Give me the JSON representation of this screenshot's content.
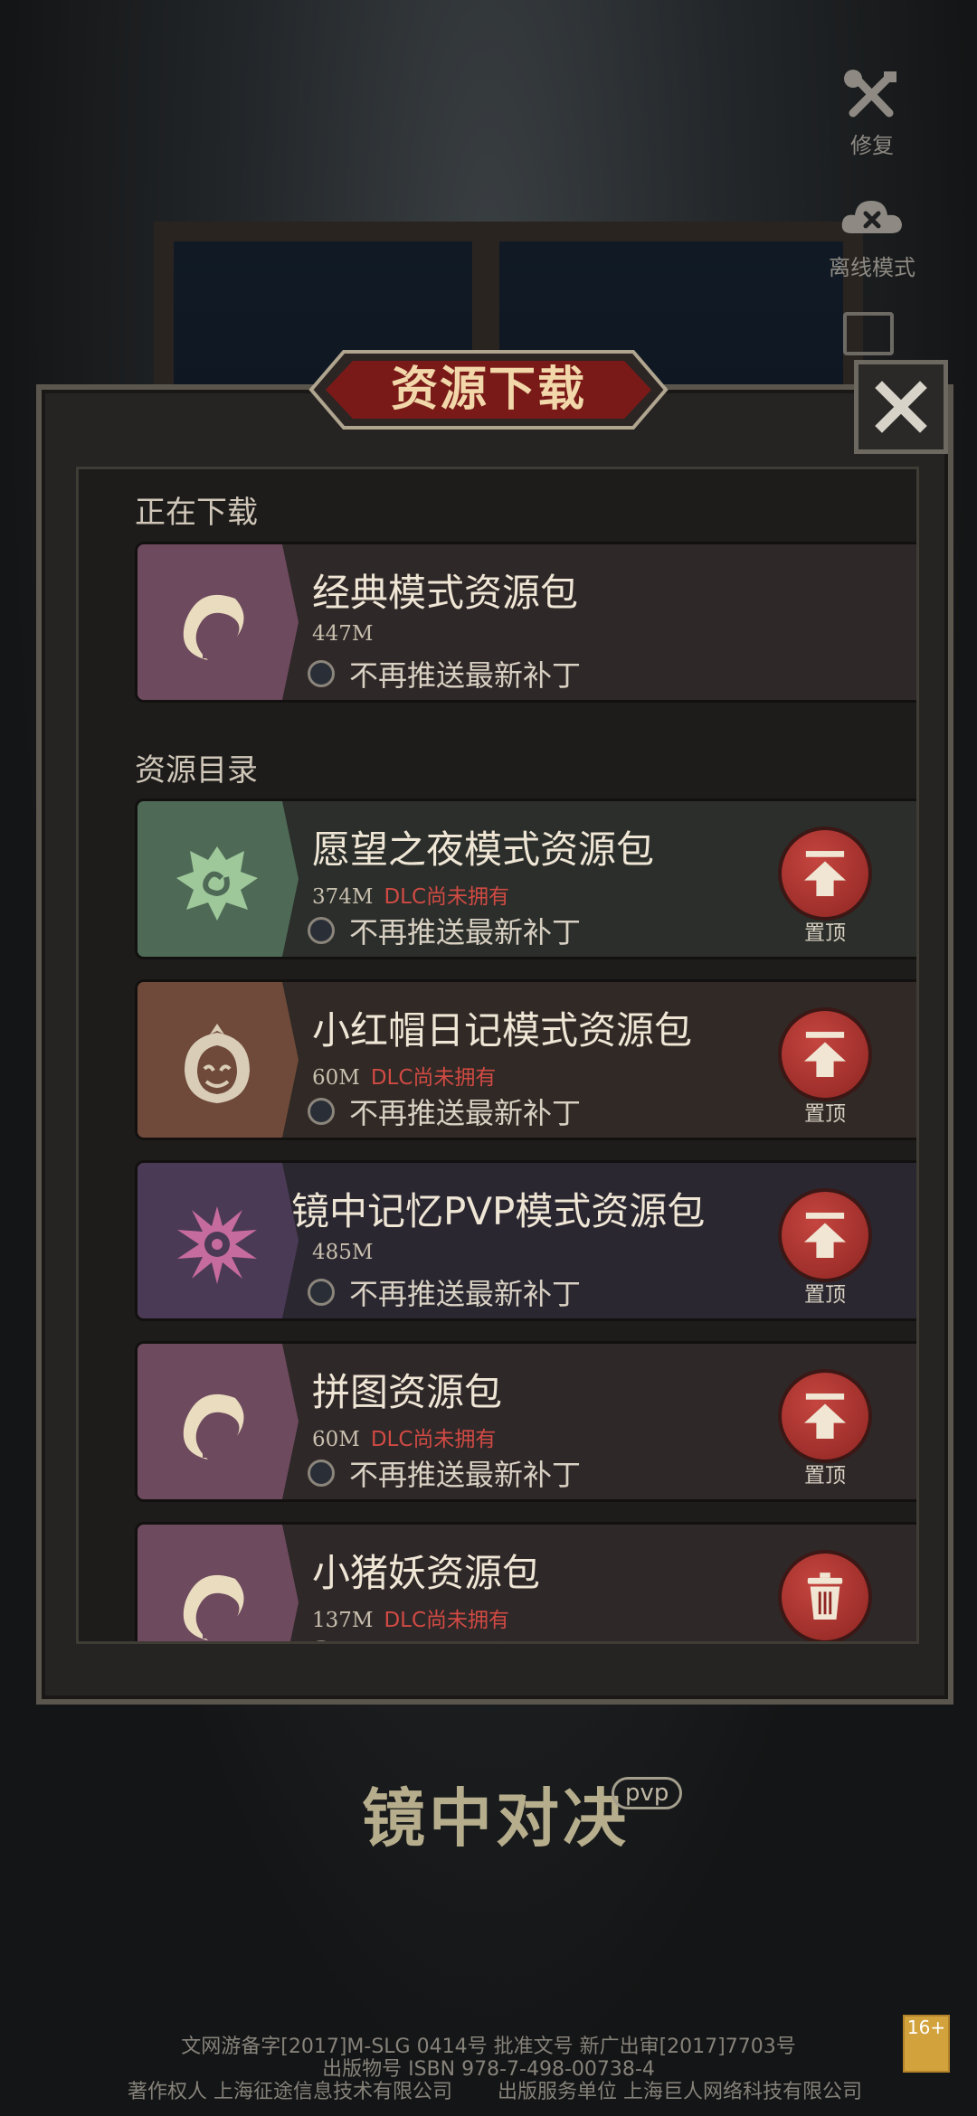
{
  "side_buttons": [
    {
      "label": "修复",
      "icon": "repair-tools-icon"
    },
    {
      "label": "离线模式",
      "icon": "offline-cloud-icon"
    }
  ],
  "dialog": {
    "title": "资源下载",
    "close_icon": "close-icon"
  },
  "sections": {
    "downloading": "正在下载",
    "catalog": "资源目录"
  },
  "downloading_item": {
    "name": "经典模式资源包",
    "size": "447M",
    "option": "不再推送最新补丁",
    "strip_color": "#6e4a5e"
  },
  "catalog_items": [
    {
      "name": "愿望之夜模式资源包",
      "size": "374M",
      "dlc": "DLC尚未拥有",
      "option": "不再推送最新补丁",
      "action": "置顶",
      "strip_color": "#4e6a56"
    },
    {
      "name": "小红帽日记模式资源包",
      "size": "60M",
      "dlc": "DLC尚未拥有",
      "option": "不再推送最新补丁",
      "action": "置顶",
      "strip_color": "#6f4a3a"
    },
    {
      "name": "镜中记忆PVP模式资源包",
      "size": "485M",
      "dlc": "",
      "option": "不再推送最新补丁",
      "action": "置顶",
      "strip_color": "#4b3a55"
    },
    {
      "name": "拼图资源包",
      "size": "60M",
      "dlc": "DLC尚未拥有",
      "option": "不再推送最新补丁",
      "action": "置顶",
      "strip_color": "#6e4a5e"
    },
    {
      "name": "小猪妖资源包",
      "size": "137M",
      "dlc": "DLC尚未拥有",
      "option": "不再推送最新补丁",
      "action_icon": "trash-icon",
      "strip_color": "#6e4a5e"
    }
  ],
  "logo": {
    "text": "镜中对决",
    "badge": "pvp"
  },
  "footer": {
    "line1": "文网游备字[2017]M-SLG 0414号 批准文号 新广出审[2017]7703号",
    "line2": "出版物号 ISBN 978-7-498-00738-4",
    "line3a": "著作权人 上海征途信息技术有限公司",
    "line3b": "出版服务单位 上海巨人网络科技有限公司",
    "age": "16+"
  }
}
